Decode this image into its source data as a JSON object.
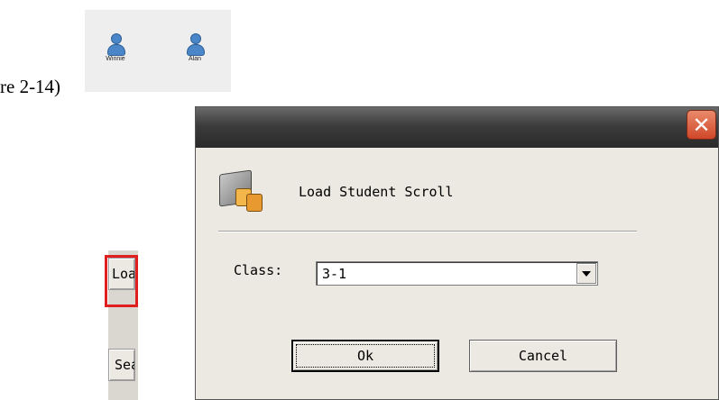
{
  "document": {
    "caption_fragment": "re 2-14)"
  },
  "students": [
    {
      "name": "Winnie"
    },
    {
      "name": "Alan"
    }
  ],
  "side_panel": {
    "loadscroll_label": "LoadScroll",
    "seat_label": "Seat",
    "highlight_color": "#e02020"
  },
  "dialog": {
    "title": "Load Student Scroll",
    "close_icon": "close-icon",
    "app_icon": "student-scroll-icon",
    "class_label": "Class:",
    "class_value": "3-1",
    "ok_label": "Ok",
    "cancel_label": "Cancel"
  }
}
